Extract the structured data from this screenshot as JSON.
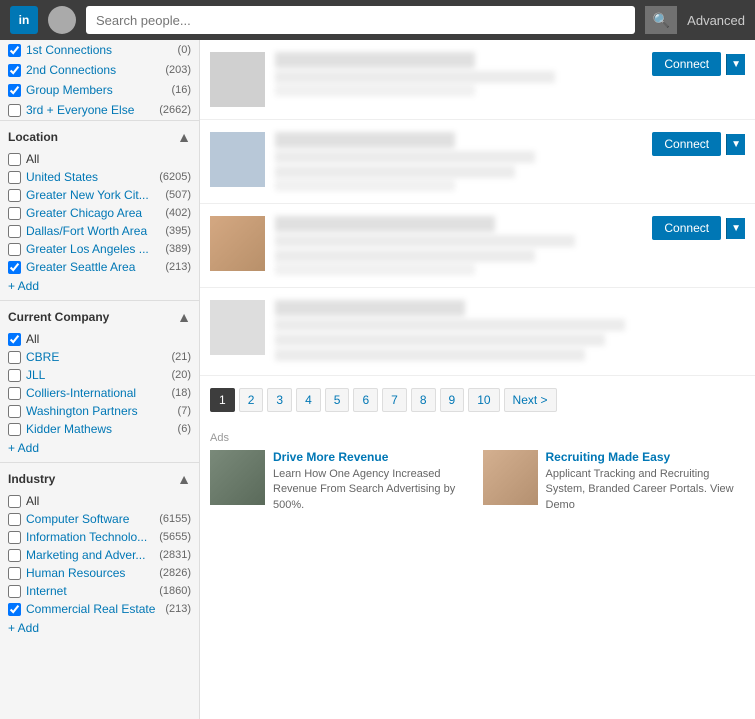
{
  "header": {
    "logo_text": "in",
    "search_placeholder": "Search people...",
    "search_icon": "🔍",
    "advanced_label": "Advanced"
  },
  "sidebar": {
    "connections": [
      {
        "id": "1st",
        "label": "1st Connections",
        "count": "(0)",
        "checked": true
      },
      {
        "id": "2nd",
        "label": "2nd Connections",
        "count": "(203)",
        "checked": true
      },
      {
        "id": "group",
        "label": "Group Members",
        "count": "(16)",
        "checked": true
      },
      {
        "id": "3rd",
        "label": "3rd + Everyone Else",
        "count": "(2662)",
        "checked": false
      }
    ],
    "location": {
      "section_title": "Location",
      "items": [
        {
          "label": "All",
          "count": "",
          "checked": false
        },
        {
          "label": "United States",
          "count": "(6205)",
          "checked": false
        },
        {
          "label": "Greater New York Cit...",
          "count": "(507)",
          "checked": false
        },
        {
          "label": "Greater Chicago Area",
          "count": "(402)",
          "checked": false
        },
        {
          "label": "Dallas/Fort Worth Area",
          "count": "(395)",
          "checked": false
        },
        {
          "label": "Greater Los Angeles ...",
          "count": "(389)",
          "checked": false
        },
        {
          "label": "Greater Seattle Area",
          "count": "(213)",
          "checked": true
        }
      ],
      "add_label": "+ Add"
    },
    "current_company": {
      "section_title": "Current Company",
      "items": [
        {
          "label": "All",
          "count": "",
          "checked": true
        },
        {
          "label": "CBRE",
          "count": "(21)",
          "checked": false
        },
        {
          "label": "JLL",
          "count": "(20)",
          "checked": false
        },
        {
          "label": "Colliers-International",
          "count": "(18)",
          "checked": false
        },
        {
          "label": "Washington Partners",
          "count": "(7)",
          "checked": false
        },
        {
          "label": "Kidder Mathews",
          "count": "(6)",
          "checked": false
        }
      ],
      "add_label": "+ Add"
    },
    "industry": {
      "section_title": "Industry",
      "items": [
        {
          "label": "All",
          "count": "",
          "checked": false
        },
        {
          "label": "Computer Software",
          "count": "(6155)",
          "checked": false
        },
        {
          "label": "Information Technolo...",
          "count": "(5655)",
          "checked": false
        },
        {
          "label": "Marketing and Adver...",
          "count": "(2831)",
          "checked": false
        },
        {
          "label": "Human Resources",
          "count": "(2826)",
          "checked": false
        },
        {
          "label": "Internet",
          "count": "(1860)",
          "checked": false
        },
        {
          "label": "Commercial Real Estate",
          "count": "(213)",
          "checked": true
        }
      ],
      "add_label": "+ Add"
    }
  },
  "pagination": {
    "pages": [
      "1",
      "2",
      "3",
      "4",
      "5",
      "6",
      "7",
      "8",
      "9",
      "10"
    ],
    "active_page": "1",
    "next_label": "Next >"
  },
  "ads": {
    "label": "Ads",
    "items": [
      {
        "title": "Drive More Revenue",
        "description": "Learn How One Agency Increased Revenue From Search Advertising by 500%."
      },
      {
        "title": "Recruiting Made Easy",
        "description": "Applicant Tracking and Recruiting System, Branded Career Portals. View Demo"
      }
    ]
  }
}
